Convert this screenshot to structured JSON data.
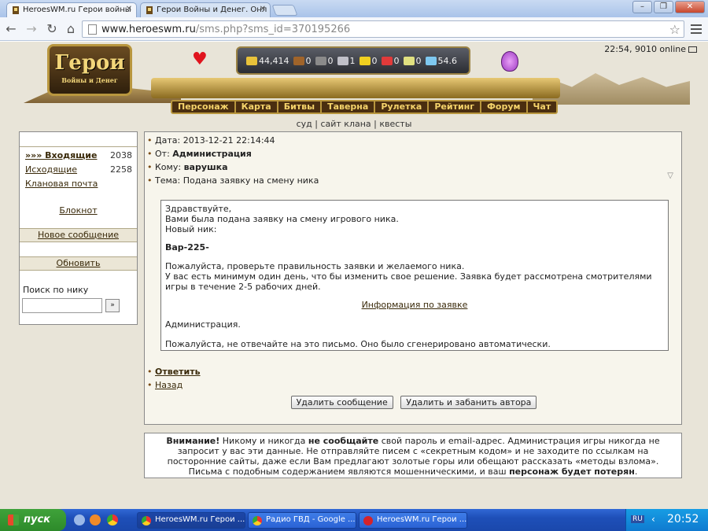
{
  "browser": {
    "tabs": [
      {
        "label": "HeroesWM.ru Герои войны",
        "active": true
      },
      {
        "label": "Герои Войны и Денег. Онл",
        "active": false
      }
    ],
    "url_domain": "www.heroeswm.ru",
    "url_path": "/sms.php?sms_id=370195266"
  },
  "game": {
    "logo_text": "Герои",
    "logo_subtext": "Войны и Денег",
    "resources": [
      {
        "icon": "gold-icon",
        "value": "44,414",
        "color": "#e8c23a"
      },
      {
        "icon": "wood-icon",
        "value": "0",
        "color": "#a0642a"
      },
      {
        "icon": "ore-icon",
        "value": "0",
        "color": "#8a8a8a"
      },
      {
        "icon": "mercury-icon",
        "value": "1",
        "color": "#c0c0c8"
      },
      {
        "icon": "sulfur-icon",
        "value": "0",
        "color": "#f0d020"
      },
      {
        "icon": "crystal-icon",
        "value": "0",
        "color": "#e03a3a"
      },
      {
        "icon": "gem-icon",
        "value": "0",
        "color": "#e0e080"
      },
      {
        "icon": "diamond-icon",
        "value": "54.6",
        "color": "#7ec8f0"
      }
    ],
    "top_info": "22:54, 9010 online",
    "nav": [
      "Персонаж",
      "Карта",
      "Битвы",
      "Таверна",
      "Рулетка",
      "Рейтинг",
      "Форум",
      "Чат"
    ],
    "sublinks": "суд | сайт клана | квесты"
  },
  "sidebar": {
    "folders": [
      {
        "label": "»»» Входящие",
        "count": "2038"
      },
      {
        "label": "Исходящие",
        "count": "2258"
      },
      {
        "label": "Клановая почта",
        "count": ""
      }
    ],
    "notebook": "Блокнот",
    "new_message": "Новое сообщение",
    "refresh": "Обновить",
    "search_label": "Поиск по нику",
    "search_button": "»"
  },
  "message": {
    "date_label": "Дата:",
    "date": "2013-12-21 22:14:44",
    "from_label": "От:",
    "from": "Администрация",
    "to_label": "Кому:",
    "to": "варушка",
    "subject_label": "Тема:",
    "subject": "Подана заявку на смену ника",
    "body": {
      "greeting": "Здравствуйте,",
      "line1": "Вами была подана заявку на смену игрового ника.",
      "line2": "Новый ник:",
      "new_nick": "Вар-225-",
      "para1": "Пожалуйста, проверьте правильность заявки и желаемого ника.",
      "para2": "У вас есть минимум один день, что бы изменить свое решение. Заявка будет рассмотрена смотрителями игры в течение 2-5 рабочих дней.",
      "info_link": "Информация по заявке",
      "signature": "Администрация.",
      "footer": "Пожалуйста, не отвечайте на это письмо. Оно было сгенерировано автоматически."
    },
    "reply": "Ответить",
    "back": "Назад",
    "delete_button": "Удалить сообщение",
    "delete_ban_button": "Удалить и забанить автора"
  },
  "warning": {
    "attention": "Внимание!",
    "text1": " Никому и никогда ",
    "strong1": "не сообщайте",
    "text2": " свой пароль и email-адрес. Администрация игры никогда не запросит у вас эти данные. Не отправляйте писем с «секретным кодом» и не заходите по ссылкам на посторонние сайты, даже если Вам предлагают золотые горы или обещают рассказать «методы взлома». Письма с подобным содержанием являются мошенническими, и ваш ",
    "strong2": "персонаж будет потерян",
    "text3": "."
  },
  "taskbar": {
    "start": "пуск",
    "tasks": [
      "HeroesWM.ru Герои ...",
      "Радио ГВД - Google ...",
      "HeroesWM.ru Герои ..."
    ],
    "lang": "RU",
    "clock": "20:52"
  }
}
